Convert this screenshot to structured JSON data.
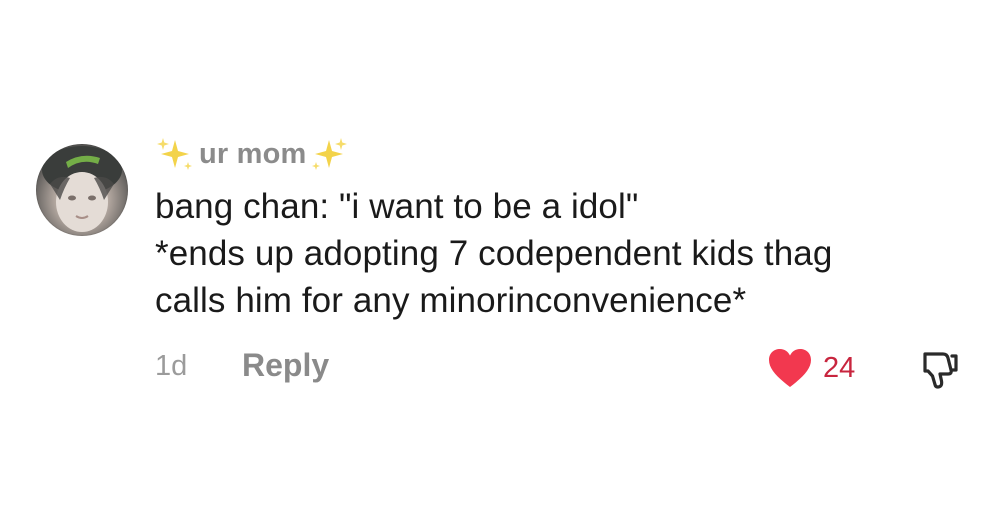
{
  "comment": {
    "username": "ur mom",
    "username_decoration_icon": "sparkles-icon",
    "avatar_icon": "user-avatar",
    "lines": [
      "bang chan: \"i want to be a idol\"",
      "*ends up adopting 7 codependent kids thag",
      "calls him for any minorinconvenience*"
    ],
    "timestamp": "1d",
    "reply_label": "Reply",
    "like_count": "24",
    "like_icon": "heart-icon",
    "dislike_icon": "thumbs-down-icon",
    "colors": {
      "heart": "#f2384f",
      "like_count": "#c8253e",
      "username": "#8b8b8b",
      "sparkle": "#f3d34a",
      "text": "#1a1a1a",
      "meta": "#9b9b9b"
    }
  }
}
